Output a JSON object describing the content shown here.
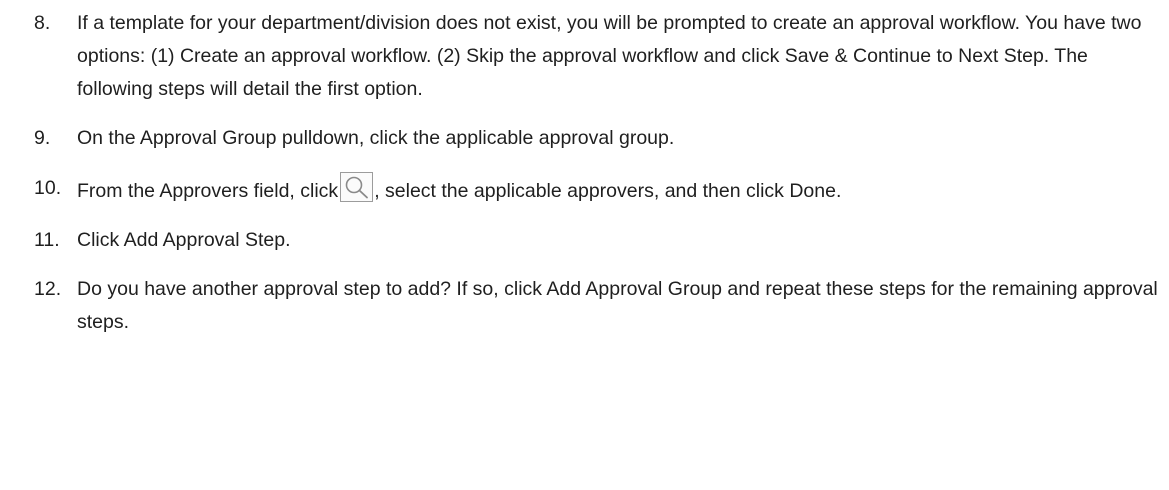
{
  "steps": [
    {
      "number": "8.",
      "text": "If a template for your department/division does not exist, you will be prompted to create an approval workflow. You have two options: (1) Create an approval workflow. (2) Skip the approval workflow and click Save & Continue to Next Step. The following steps will detail the first option."
    },
    {
      "number": "9.",
      "text": "On the Approval Group pulldown, click the applicable approval group."
    },
    {
      "number": "10.",
      "text_before": "From the Approvers field, click",
      "icon": "search-icon",
      "text_after": ", select the applicable approvers, and then click Done."
    },
    {
      "number": "11.",
      "text": "Click Add Approval Step."
    },
    {
      "number": "12.",
      "text": "Do you have another approval step to add? If so, click Add Approval Group and repeat these steps for the remaining approval steps."
    }
  ]
}
